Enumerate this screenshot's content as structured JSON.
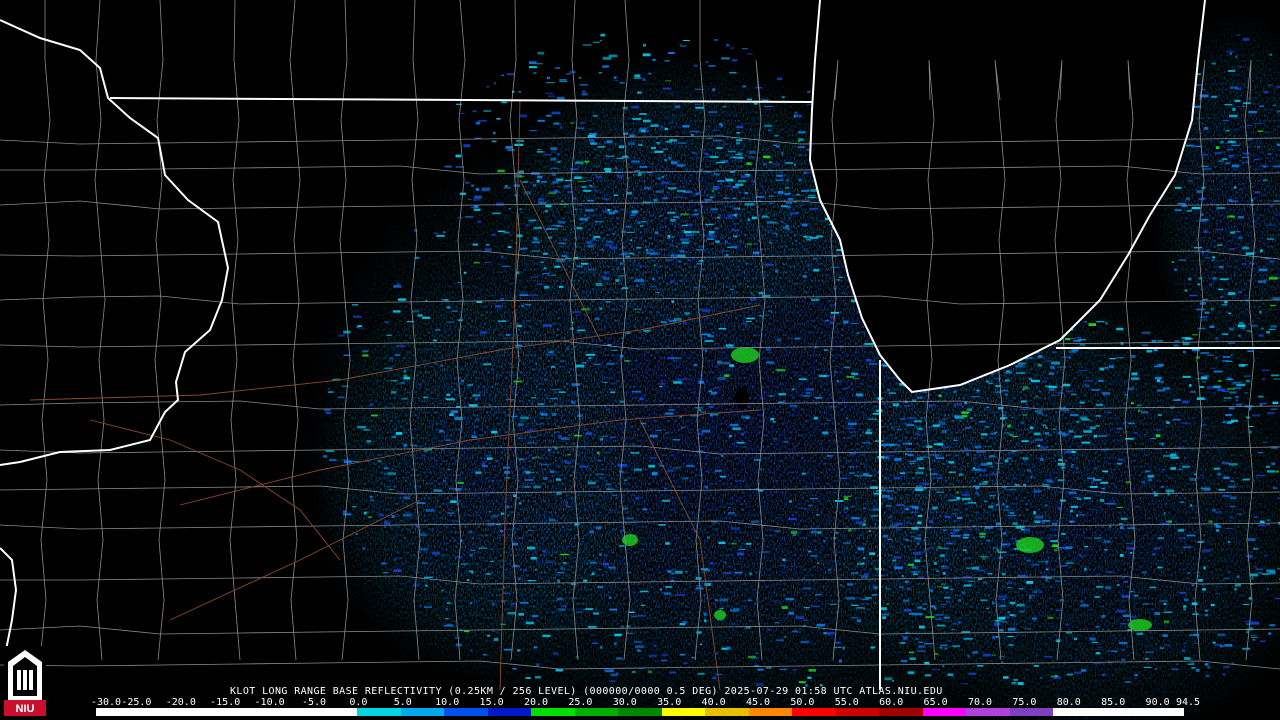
{
  "caption": "KLOT LONG RANGE BASE REFLECTIVITY (0.25KM / 256 LEVEL) (000000/0000 0.5 DEG) 2025-07-29 01:58 UTC  ATLAS.NIU.EDU",
  "logo": {
    "text": "NIU",
    "color": "#c8102e"
  },
  "legend": {
    "ticks": [
      "-30.0",
      "-25.0",
      "-20.0",
      "-15.0",
      "-10.0",
      "-5.0",
      "0.0",
      "5.0",
      "10.0",
      "15.0",
      "20.0",
      "25.0",
      "30.0",
      "35.0",
      "40.0",
      "45.0",
      "50.0",
      "55.0",
      "60.0",
      "65.0",
      "70.0",
      "75.0",
      "80.0",
      "85.0",
      "90.0",
      "94.5"
    ],
    "colors": [
      "#ffffff",
      "#ffffff",
      "#ffffff",
      "#ffffff",
      "#ffffff",
      "#ffffff",
      "#00d8e0",
      "#00a8f0",
      "#0050f0",
      "#0018c8",
      "#00e000",
      "#00b000",
      "#008800",
      "#ffff00",
      "#e8c000",
      "#ff8800",
      "#ff0000",
      "#d00000",
      "#a00000",
      "#ff00ff",
      "#b040e0",
      "#8040c0",
      "#ffffff",
      "#ffffff",
      "#ffffff"
    ]
  },
  "map_colors": {
    "border": "#ffffff",
    "county": "#8a8a8a",
    "road": "#8b4a2b",
    "echo_light": "#00c8e8",
    "echo_mid": "#0a78e0",
    "echo_dark": "#1440d0",
    "echo_green": "#1ed21e"
  }
}
